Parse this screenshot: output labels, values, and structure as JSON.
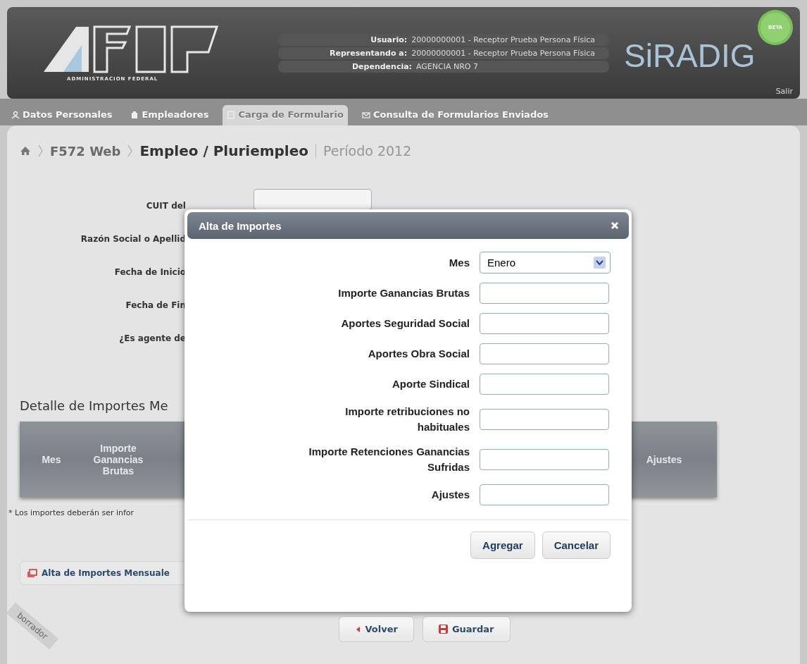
{
  "header": {
    "logo_caption": "ADMINISTRACION FEDERAL",
    "user_info": [
      {
        "label": "Usuario:",
        "value": "20000000001 - Receptor Prueba Persona Física"
      },
      {
        "label": "Representando a:",
        "value": "20000000001 - Receptor Prueba Persona Física"
      },
      {
        "label": "Dependencia:",
        "value": "AGENCIA NRO 7"
      }
    ],
    "app_name": "SiRADIG",
    "badge": "BETA",
    "logout": "Salir"
  },
  "tabs": [
    {
      "label": "Datos Personales",
      "selected": false
    },
    {
      "label": "Empleadores",
      "selected": false
    },
    {
      "label": "Carga de Formulario",
      "selected": true
    },
    {
      "label": "Consulta de Formularios Enviados",
      "selected": false
    }
  ],
  "breadcrumb": {
    "items": [
      "F572 Web",
      "Empleo / Pluriempleo"
    ],
    "period": "Período 2012"
  },
  "form": {
    "labels": [
      "CUIT del",
      "Razón Social o Apellid",
      "Fecha de Inicio",
      "Fecha de Fin",
      "¿Es agente de"
    ]
  },
  "detail": {
    "title": "Detalle de Importes Me",
    "columns": [
      "Mes",
      "Importe Ganancias Brutas",
      "Ajustes"
    ],
    "note": "* Los importes deberán ser infor",
    "add_button": "Alta de Importes Mensuale"
  },
  "actions": [
    {
      "label": "Volver",
      "kind": "back"
    },
    {
      "label": "Guardar",
      "kind": "save"
    }
  ],
  "ribbon": "borrador",
  "dialog": {
    "title": "Alta de Importes",
    "fields": [
      {
        "label": "Mes",
        "kind": "select",
        "value": "Enero"
      },
      {
        "label": "Importe Ganancias Brutas",
        "kind": "input"
      },
      {
        "label": "Aportes Seguridad Social",
        "kind": "input"
      },
      {
        "label": "Aportes Obra Social",
        "kind": "input"
      },
      {
        "label": "Aporte Sindical",
        "kind": "input"
      },
      {
        "label": "Importe retribuciones no habituales",
        "kind": "input"
      },
      {
        "label": "Importe Retenciones Ganancias Sufridas",
        "kind": "input"
      },
      {
        "label": "Ajustes",
        "kind": "input"
      }
    ],
    "buttons": [
      "Agregar",
      "Cancelar"
    ]
  }
}
